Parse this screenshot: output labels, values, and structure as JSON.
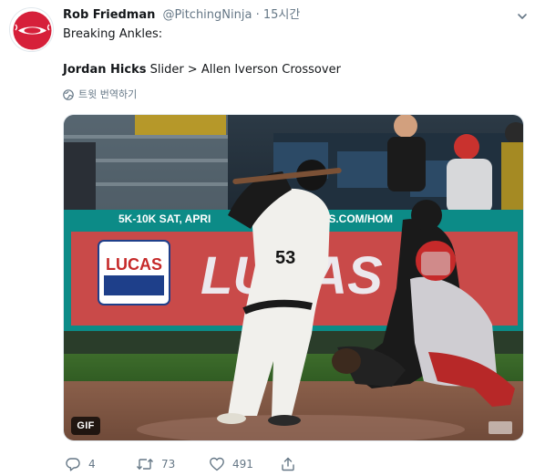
{
  "tweet": {
    "author_name": "Rob Friedman",
    "author_handle": "@PitchingNinja",
    "separator": "·",
    "time": "15시간",
    "text_line1": "Breaking Ankles:",
    "text_line2_bold": "Jordan Hicks",
    "text_line2_rest": " Slider > Allen Iverson Crossover",
    "translate_label": "트윗 번역하기"
  },
  "media": {
    "type_badge": "GIF",
    "banner_text": "5K-10K  SAT, APRI",
    "banner_text_right": "TES.COM/HOM",
    "wall_text": "LUCAS",
    "sponsor_logo_text": "LUCAS",
    "jersey_number": "53"
  },
  "actions": {
    "reply_count": "4",
    "retweet_count": "73",
    "like_count": "491"
  },
  "icons": {
    "avatar": "ninja-baseball-avatar",
    "caret": "chevron-down-icon",
    "translate": "globe-icon",
    "reply": "reply-icon",
    "retweet": "retweet-icon",
    "like": "heart-icon",
    "share": "share-icon"
  },
  "colors": {
    "name": "#14171a",
    "muted": "#657786",
    "avatar_red": "#d6203a",
    "banner_teal": "#0c8b87",
    "wall_red": "#c94a49"
  }
}
